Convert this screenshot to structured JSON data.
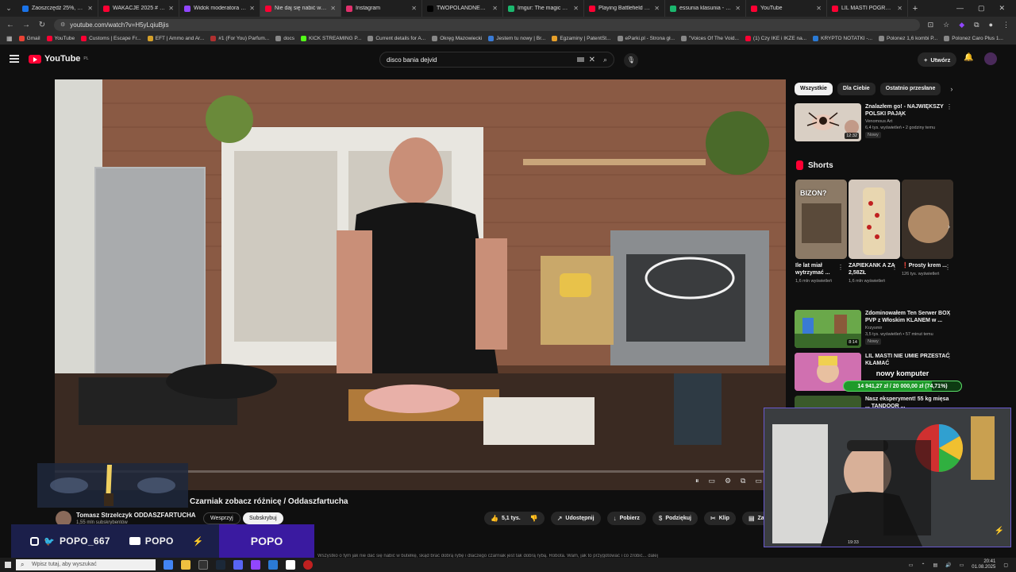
{
  "browser": {
    "tabs": [
      {
        "title": "Zaoszczędź 25%, kupując",
        "color": "#1a73e8",
        "active": false
      },
      {
        "title": "WAKACJE 2025 # ENDRU",
        "color": "#ff0033",
        "active": false
      },
      {
        "title": "Widok moderatora kanał",
        "color": "#9146ff",
        "active": false
      },
      {
        "title": "Nie daj się nabić w butel",
        "color": "#ff0033",
        "active": true
      },
      {
        "title": "Instagram",
        "color": "#e1306c",
        "active": false
      },
      {
        "title": "TWOPOLANDNEWS @ w",
        "color": "#000000",
        "active": false
      },
      {
        "title": "Imgur: The magic of the I",
        "color": "#1bb76e",
        "active": false
      },
      {
        "title": "Playing Battlefield 1942 In",
        "color": "#ff0033",
        "active": false
      },
      {
        "title": "essunia klasunia - Imgur",
        "color": "#1bb76e",
        "active": false
      },
      {
        "title": "YouTube",
        "color": "#ff0033",
        "active": false
      },
      {
        "title": "LIL MASTI POGRĄŻONA",
        "color": "#ff0033",
        "active": false
      }
    ],
    "url": "youtube.com/watch?v=H5yLqiuBjis",
    "bookmarks": [
      {
        "label": "Gmail",
        "color": "#ea4335"
      },
      {
        "label": "YouTube",
        "color": "#ff0033"
      },
      {
        "label": "Customs | Escape Fr...",
        "color": "#ff0033"
      },
      {
        "label": "EFT | Ammo and Ar...",
        "color": "#d4a02a"
      },
      {
        "label": "#1 (For You) Parfum...",
        "color": "#b03030"
      },
      {
        "label": "docs",
        "color": "#888888"
      },
      {
        "label": "KICK STREAMING P...",
        "color": "#53fc18"
      },
      {
        "label": "Current details for A...",
        "color": "#888888"
      },
      {
        "label": "Okręg Mazowiecki",
        "color": "#888888"
      },
      {
        "label": "Jestem tu nowy | Br...",
        "color": "#3a7bd5"
      },
      {
        "label": "Egzaminy | PatentSt...",
        "color": "#e7a02a"
      },
      {
        "label": "eParki.pl - Strona gł...",
        "color": "#888888"
      },
      {
        "label": "\"Voices Of The Void...",
        "color": "#888888"
      },
      {
        "label": "(1) Czy IKE i IKZE na...",
        "color": "#ff0033"
      },
      {
        "label": "KRYPTO NOTATKI -...",
        "color": "#2a7ad5"
      },
      {
        "label": "Polonez 1,6 kombi P...",
        "color": "#888888"
      },
      {
        "label": "Polonez Caro Plus 1...",
        "color": "#888888"
      }
    ]
  },
  "youtube": {
    "logo_text": "YouTube",
    "region": "PL",
    "search_query": "disco bania dejvid",
    "create_label": "Utwórz",
    "video_title": "Czarniak zobacz różnicę / Oddaszfartucha",
    "channel_name": "Tomasz Strzelczyk ODDASZFARTUCHA",
    "channel_subs": "1,55 mln subskrybentów",
    "join_label": "Wesprzyj",
    "subscribe_label": "Subskrybuj",
    "actions": {
      "likes": "5,1 tys.",
      "share": "Udostępnij",
      "download": "Pobierz",
      "thanks": "Podziękuj",
      "clip": "Klip",
      "save": "Zapisz"
    },
    "description": "Wszystko o tym jak nie dać się nabić w butelkę, skąd brać dobrą rybę i dlaczego czarniak jest tak dobrą rybą. Robota. Wam, jak to przygotować i co zrobić... dalej"
  },
  "sidebar": {
    "chips": [
      "Wszystkie",
      "Dla Ciebie",
      "Ostatnio przesłane"
    ],
    "rec1": {
      "title": "Znalazłem go! - NAJWIĘKSZY POLSKI PAJĄK",
      "channel": "Venomous Art",
      "meta": "6,4 tys. wyświetleń • 2 godziny temu",
      "badge": "Nowy",
      "duration": "12:32"
    },
    "shorts_label": "Shorts",
    "shorts": [
      {
        "title": "Ile lat miał wytrzymać ...",
        "views": "1,6 mln wyświetleń",
        "overlay": "BIZON?"
      },
      {
        "title": "ZAPIEKANK A ZA 2,58ZŁ",
        "views": "1,6 mln wyświetleń",
        "overlay": ""
      },
      {
        "title": "❗Prosty krem ...",
        "views": "126 tys. wyświetleń",
        "overlay": ""
      }
    ],
    "rec2": {
      "title": "Zdominowałem Ten Serwer BOX PVP z Włoskim KLANEM w ...",
      "channel": "Krzysmir",
      "meta": "3,5 tys. wyświetleń • 57 minut temu",
      "badge": "Nowy",
      "duration": "8:14"
    },
    "rec3": {
      "title": "LIL MASTI NIE UMIE PRZESTAĆ KŁAMAĆ",
      "channel": "",
      "meta": "",
      "badge": "",
      "duration": ""
    },
    "rec4": {
      "title": "Nasz eksperyment! 55 kg mięsa ... TANDOOR ..."
    }
  },
  "overlay": {
    "goal_title": "nowy komputer",
    "goal_progress": "14 941,27 zł / 20 000,00 zł (74,71%)",
    "goal_fraction": 0.7471,
    "social_handle": "POPO_667",
    "youtube_handle": "POPO",
    "brand": "POPO",
    "webcam_time": "19:33"
  },
  "taskbar": {
    "search_placeholder": "Wpisz tutaj, aby wyszukać",
    "time": "20:41",
    "date": "01.08.2025"
  }
}
